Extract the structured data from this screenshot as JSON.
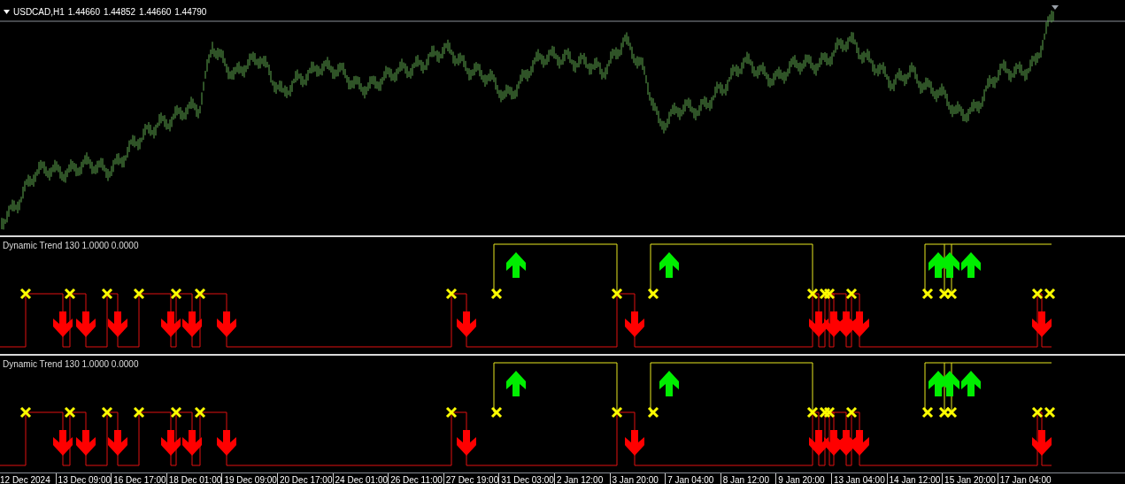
{
  "main_chart": {
    "symbol": "USDCAD,H1",
    "prices": [
      "1.44660",
      "1.44852",
      "1.44660",
      "1.44790"
    ]
  },
  "indicator_panels": [
    {
      "label": "Dynamic Trend 130 1.0000 0.0000"
    },
    {
      "label": "Dynamic Trend 130 1.0000 0.0000"
    }
  ],
  "time_axis": {
    "labels": [
      "12 Dec 2024",
      "13 Dec 09:00",
      "16 Dec 17:00",
      "18 Dec 01:00",
      "19 Dec 09:00",
      "20 Dec 17:00",
      "24 Dec 01:00",
      "26 Dec 11:00",
      "27 Dec 19:00",
      "31 Dec 03:00",
      "2 Jan 12:00",
      "3 Jan 20:00",
      "7 Jan 04:00",
      "8 Jan 12:00",
      "9 Jan 20:00",
      "13 Jan 04:00",
      "14 Jan 12:00",
      "15 Jan 20:00",
      "17 Jan 04:00"
    ]
  }
}
